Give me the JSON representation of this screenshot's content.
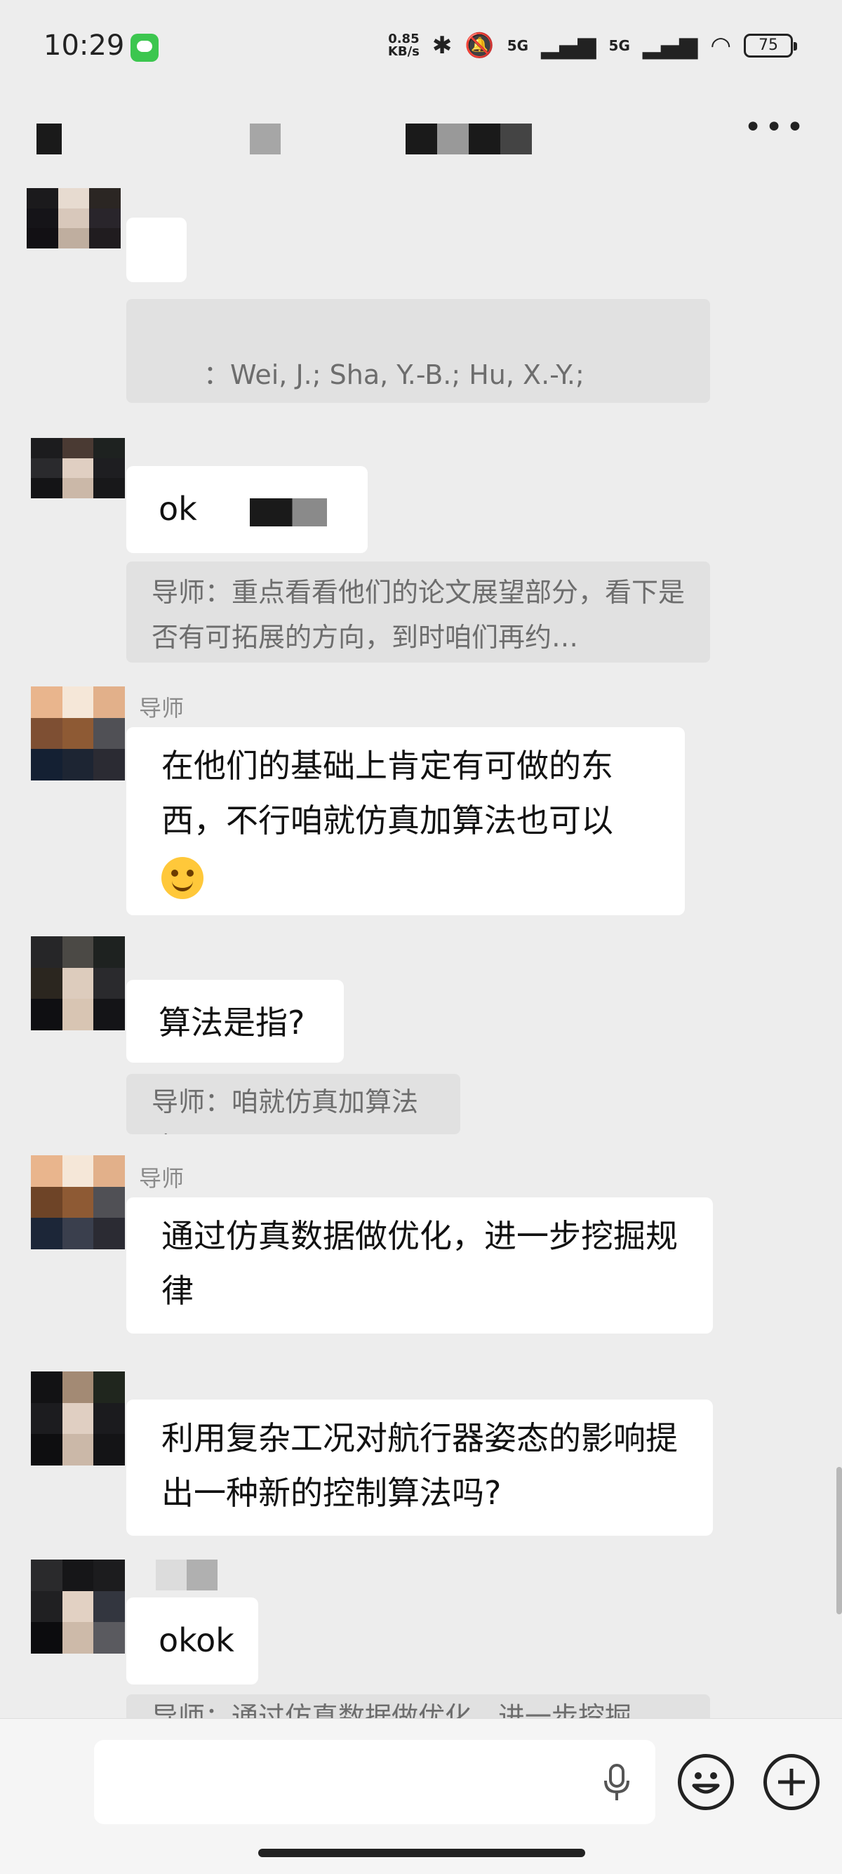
{
  "status_bar": {
    "time": "10:29",
    "net_speed_value": "0.85",
    "net_speed_unit": "KB/s",
    "signal_1": "5G",
    "signal_2": "5G",
    "battery": "75"
  },
  "messages": [
    {
      "quote_text": "：Wei, J.; Sha, Y.-B.; Hu, X.-Y.;\nZ.; Chen, D.-P.; Zhou, D.; Chen, Y.…"
    },
    {
      "bubble_text": "ok"
    },
    {
      "quote_text": "导师：重点看看他们的论文展望部分，看下是否有可拓展的方向，到时咱们再约…"
    },
    {
      "sender": "导师",
      "bubble_text": "在他们的基础上肯定有可做的东西，不行咱就仿真加算法也可以"
    },
    {
      "bubble_text": "算法是指?"
    },
    {
      "quote_text": "导师：咱就仿真加算法也"
    },
    {
      "sender": "导师",
      "bubble_text": "通过仿真数据做优化，进一步挖掘规律"
    },
    {
      "bubble_text": "利用复杂工况对航行器姿态的影响提出一种新的控制算法吗?"
    },
    {
      "bubble_text": "okok"
    },
    {
      "quote_text": "导师：通过仿真数据做优化，进一步挖掘"
    }
  ],
  "input": {
    "placeholder": ""
  },
  "icons": {
    "voice": "microphone-icon",
    "emoji": "smiley-icon",
    "more": "plus-icon",
    "menu": "more-dots-icon"
  }
}
